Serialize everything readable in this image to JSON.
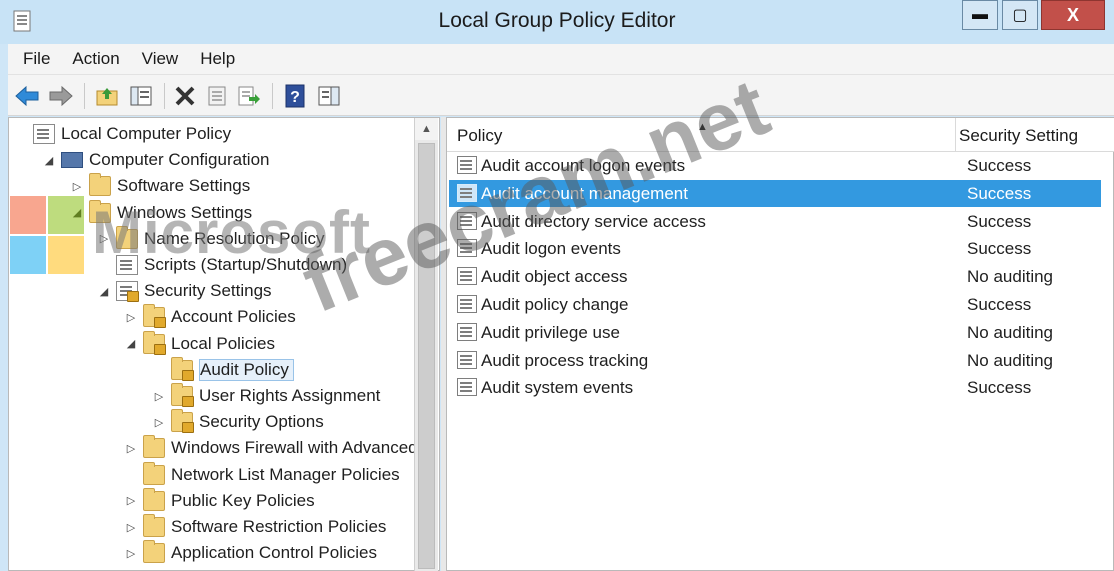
{
  "window": {
    "title": "Local Group Policy Editor",
    "controls": {
      "minimize": "▬",
      "maximize": "▢",
      "close": "X"
    }
  },
  "menu": [
    "File",
    "Action",
    "View",
    "Help"
  ],
  "toolbar": {
    "buttons": [
      "back-arrow-icon",
      "forward-arrow-icon",
      "up-folder-icon",
      "show-hide-tree-icon",
      "delete-icon",
      "properties-icon",
      "export-list-icon",
      "help-icon",
      "show-hide-action-pane-icon"
    ]
  },
  "tree": {
    "items": [
      {
        "label": "Local Computer Policy",
        "level": 0,
        "expander": "",
        "icon": "doc"
      },
      {
        "label": "Computer Configuration",
        "level": 1,
        "expander": "◢",
        "icon": "computer"
      },
      {
        "label": "Software Settings",
        "level": 2,
        "expander": "▷",
        "icon": "folder"
      },
      {
        "label": "Windows Settings",
        "level": 2,
        "expander": "◢",
        "icon": "folder"
      },
      {
        "label": "Name Resolution Policy",
        "level": 3,
        "expander": "▷",
        "icon": "folder"
      },
      {
        "label": "Scripts (Startup/Shutdown)",
        "level": 3,
        "expander": "",
        "icon": "doc"
      },
      {
        "label": "Security Settings",
        "level": 3,
        "expander": "◢",
        "icon": "lock"
      },
      {
        "label": "Account Policies",
        "level": 4,
        "expander": "▷",
        "icon": "folder-lock"
      },
      {
        "label": "Local Policies",
        "level": 4,
        "expander": "◢",
        "icon": "folder-lock"
      },
      {
        "label": "Audit Policy",
        "level": 5,
        "expander": "",
        "icon": "folder-lock",
        "selected": true
      },
      {
        "label": "User Rights Assignment",
        "level": 5,
        "expander": "▷",
        "icon": "folder-lock"
      },
      {
        "label": "Security Options",
        "level": 5,
        "expander": "▷",
        "icon": "folder-lock"
      },
      {
        "label": "Windows Firewall with Advanced",
        "level": 4,
        "expander": "▷",
        "icon": "folder"
      },
      {
        "label": "Network List Manager Policies",
        "level": 4,
        "expander": "",
        "icon": "folder"
      },
      {
        "label": "Public Key Policies",
        "level": 4,
        "expander": "▷",
        "icon": "folder"
      },
      {
        "label": "Software Restriction Policies",
        "level": 4,
        "expander": "▷",
        "icon": "folder"
      },
      {
        "label": "Application Control Policies",
        "level": 4,
        "expander": "▷",
        "icon": "folder"
      }
    ]
  },
  "list": {
    "columns": {
      "policy": "Policy",
      "setting": "Security Setting"
    },
    "rows": [
      {
        "policy": "Audit account logon events",
        "setting": "Success"
      },
      {
        "policy": "Audit account management",
        "setting": "Success",
        "selected": true
      },
      {
        "policy": "Audit directory service access",
        "setting": "Success"
      },
      {
        "policy": "Audit logon events",
        "setting": "Success"
      },
      {
        "policy": "Audit object access",
        "setting": "No auditing"
      },
      {
        "policy": "Audit policy change",
        "setting": "Success"
      },
      {
        "policy": "Audit privilege use",
        "setting": "No auditing"
      },
      {
        "policy": "Audit process tracking",
        "setting": "No auditing"
      },
      {
        "policy": "Audit system events",
        "setting": "Success"
      }
    ]
  },
  "watermark": {
    "brand": "Microsoft",
    "site": "freecram.net"
  },
  "colors": {
    "selection": "#3399e0",
    "titlebar": "#c8e3f6",
    "close": "#c2504a"
  }
}
